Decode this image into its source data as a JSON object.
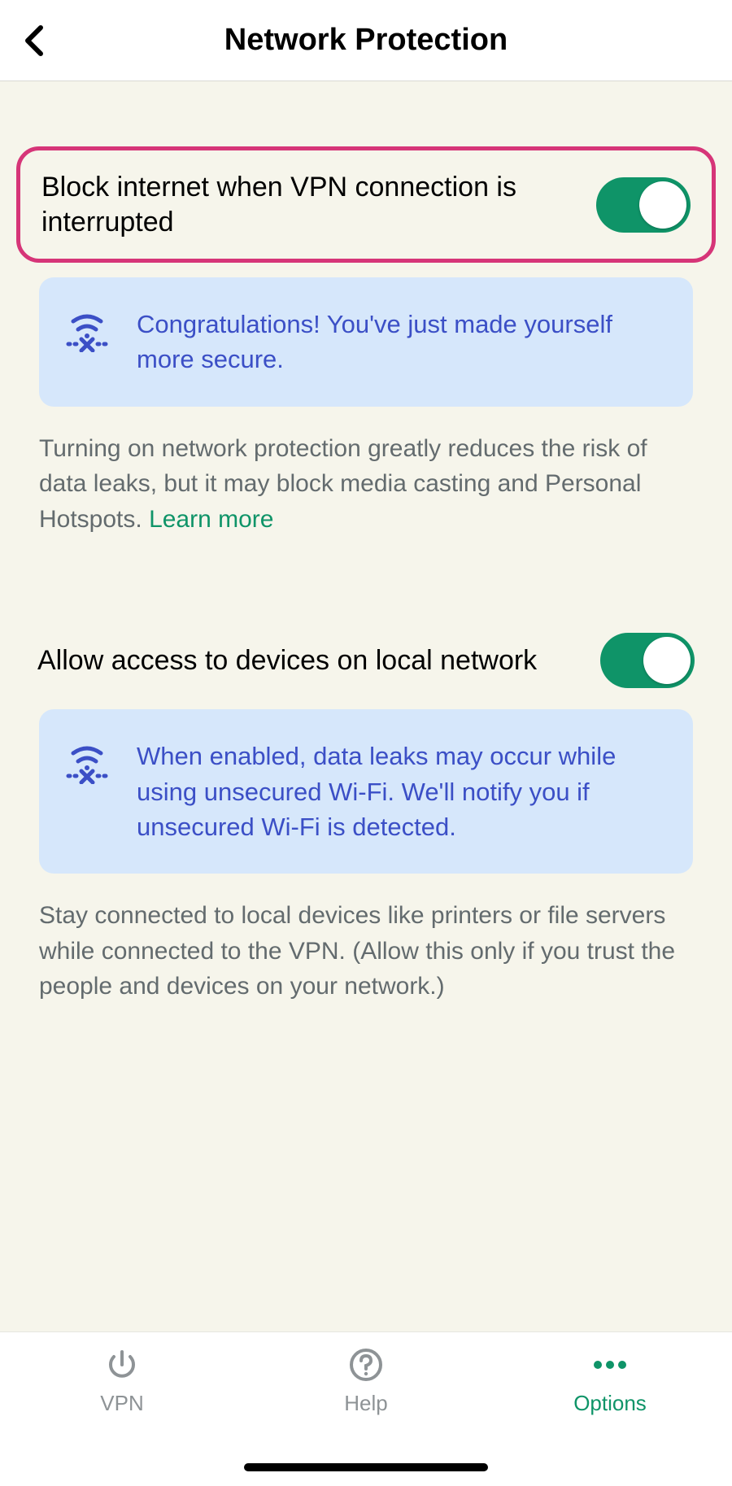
{
  "header": {
    "title": "Network Protection"
  },
  "settings": {
    "block_internet": {
      "label": "Block internet when VPN connection is interrupted",
      "on": true,
      "info": "Congratulations! You've just made yourself more secure.",
      "desc": "Turning on network protection greatly reduces the risk of data leaks, but it may block media casting and Personal Hotspots. ",
      "learn_more": "Learn more"
    },
    "local_network": {
      "label": "Allow access to devices on local network",
      "on": true,
      "info": "When enabled, data leaks may occur while using unsecured Wi-Fi. We'll notify you if unsecured Wi-Fi is detected.",
      "desc": "Stay connected to local devices like printers or file servers while connected to the VPN. (Allow this only if you trust the people and devices on your network.)"
    }
  },
  "tabs": {
    "vpn": "VPN",
    "help": "Help",
    "options": "Options"
  },
  "colors": {
    "accent": "#0f9468",
    "highlight_border": "#d63578",
    "info_bg": "#d6e7fb",
    "info_text": "#3b4fc6"
  }
}
